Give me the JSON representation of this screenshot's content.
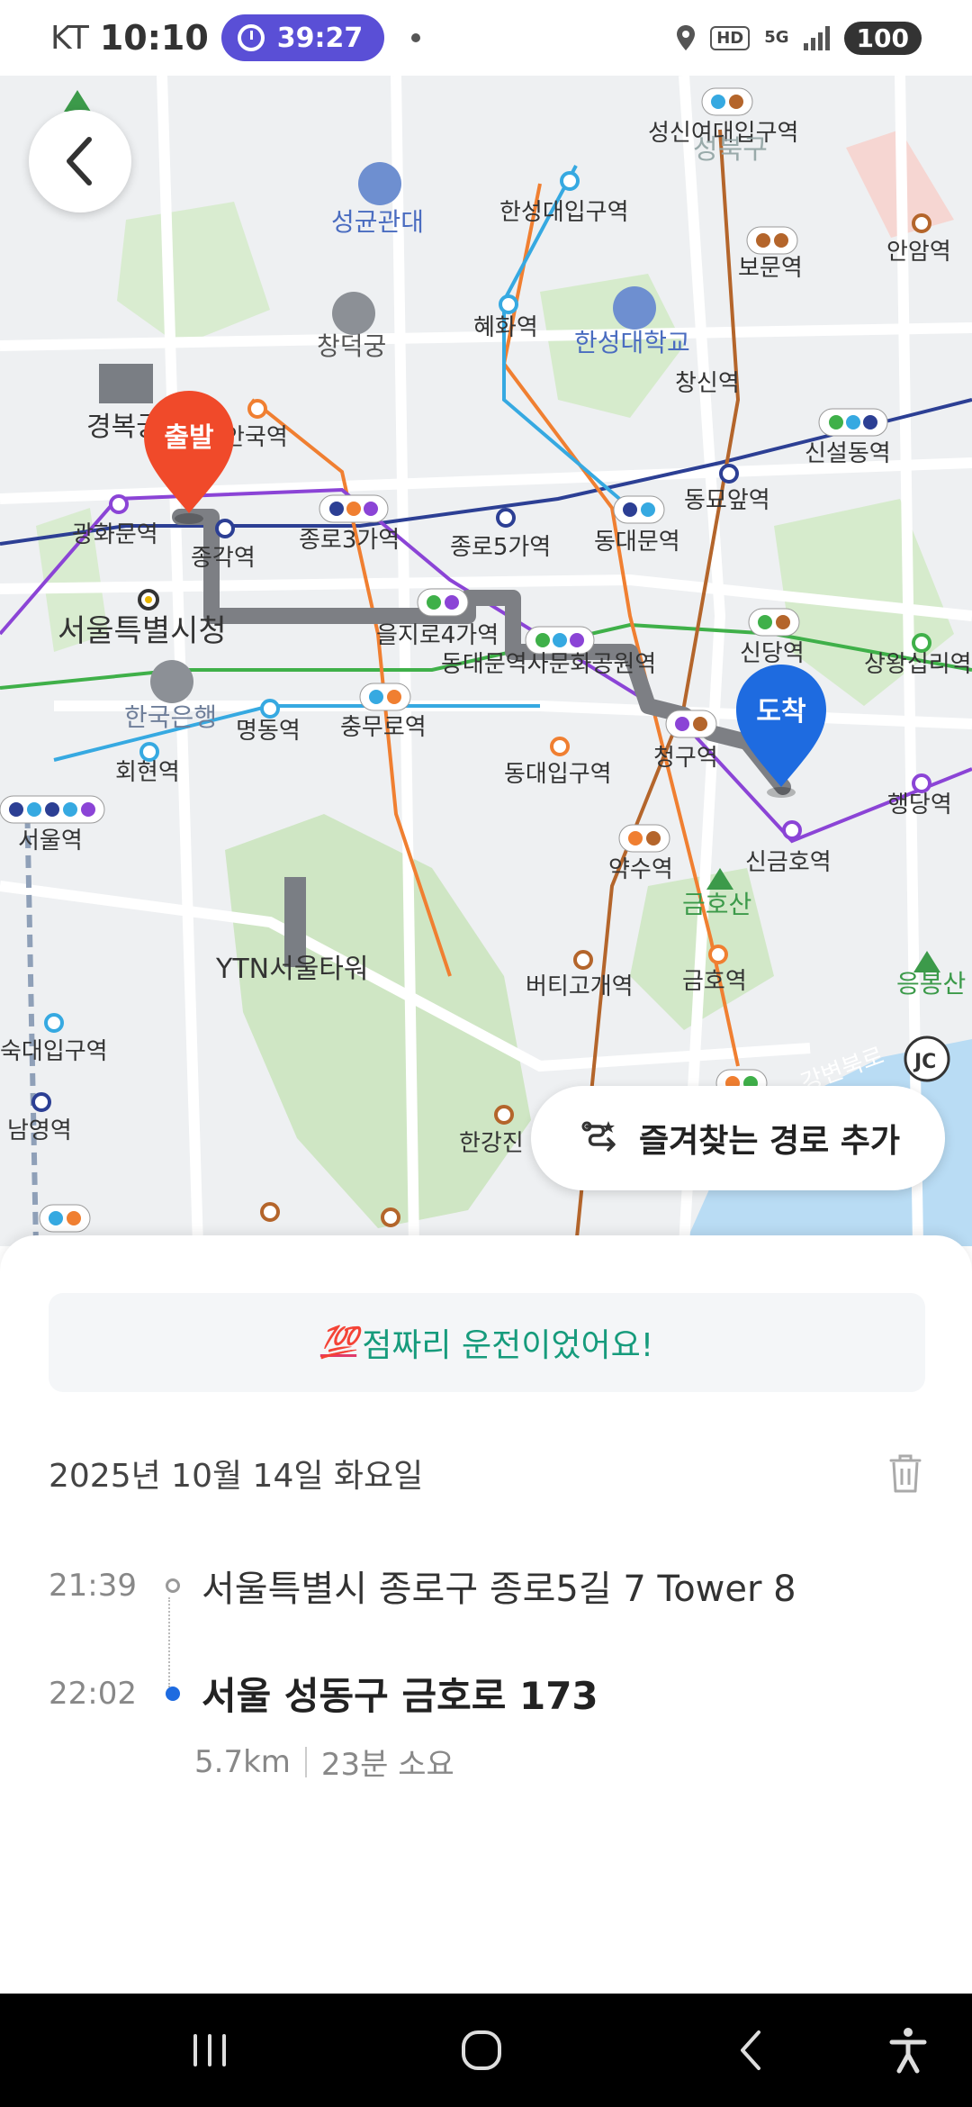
{
  "status_bar": {
    "carrier": "KT",
    "time": "10:10",
    "timer": "39:27",
    "network": "5G",
    "hd": "HD",
    "battery": "100"
  },
  "map": {
    "pins": {
      "start": "출발",
      "end": "도착"
    },
    "colors": {
      "route": "#7d7f84",
      "start_pin": "#f04a2a",
      "end_pin": "#1e6be0",
      "line1": "#2c3f94",
      "line2": "#3fb049",
      "line3": "#f07f31",
      "line4": "#36a9e1",
      "line5": "#8b44d6",
      "line6": "#b4652b"
    },
    "labels": [
      "성신여대입구역",
      "성북구",
      "한성대입구역",
      "성균관대",
      "안암역",
      "보문역",
      "혜화역",
      "한성대학교",
      "창덕궁",
      "창신역",
      "경복궁",
      "안국역",
      "신설동역",
      "광화문역",
      "종각역",
      "종로3가역",
      "종로5가역",
      "동대문역",
      "동묘앞역",
      "서울특별시청",
      "을지로4가역",
      "동대문역사문화공원역",
      "신당역",
      "상왕십리역",
      "한국은행",
      "명동역",
      "충무로역",
      "청구역",
      "회현역",
      "동대입구역",
      "행당역",
      "서울역",
      "약수역",
      "신금호역",
      "금호산",
      "YTN서울타워",
      "버티고개역",
      "금호역",
      "응봉산",
      "숙대입구역",
      "남영역",
      "한강진",
      "강변북로",
      "JC"
    ]
  },
  "favorite_button": {
    "label": "즐겨찾는 경로 추가"
  },
  "trip": {
    "banner_badge": "💯",
    "banner_text": "점짜리 운전이었어요!",
    "date": "2025년 10월 14일 화요일",
    "start_time": "21:39",
    "start_address": "서울특별시 종로구 종로5길 7 Tower 8",
    "end_time": "22:02",
    "end_address": "서울 성동구 금호로 173",
    "distance": "5.7km",
    "duration": "23분 소요"
  }
}
